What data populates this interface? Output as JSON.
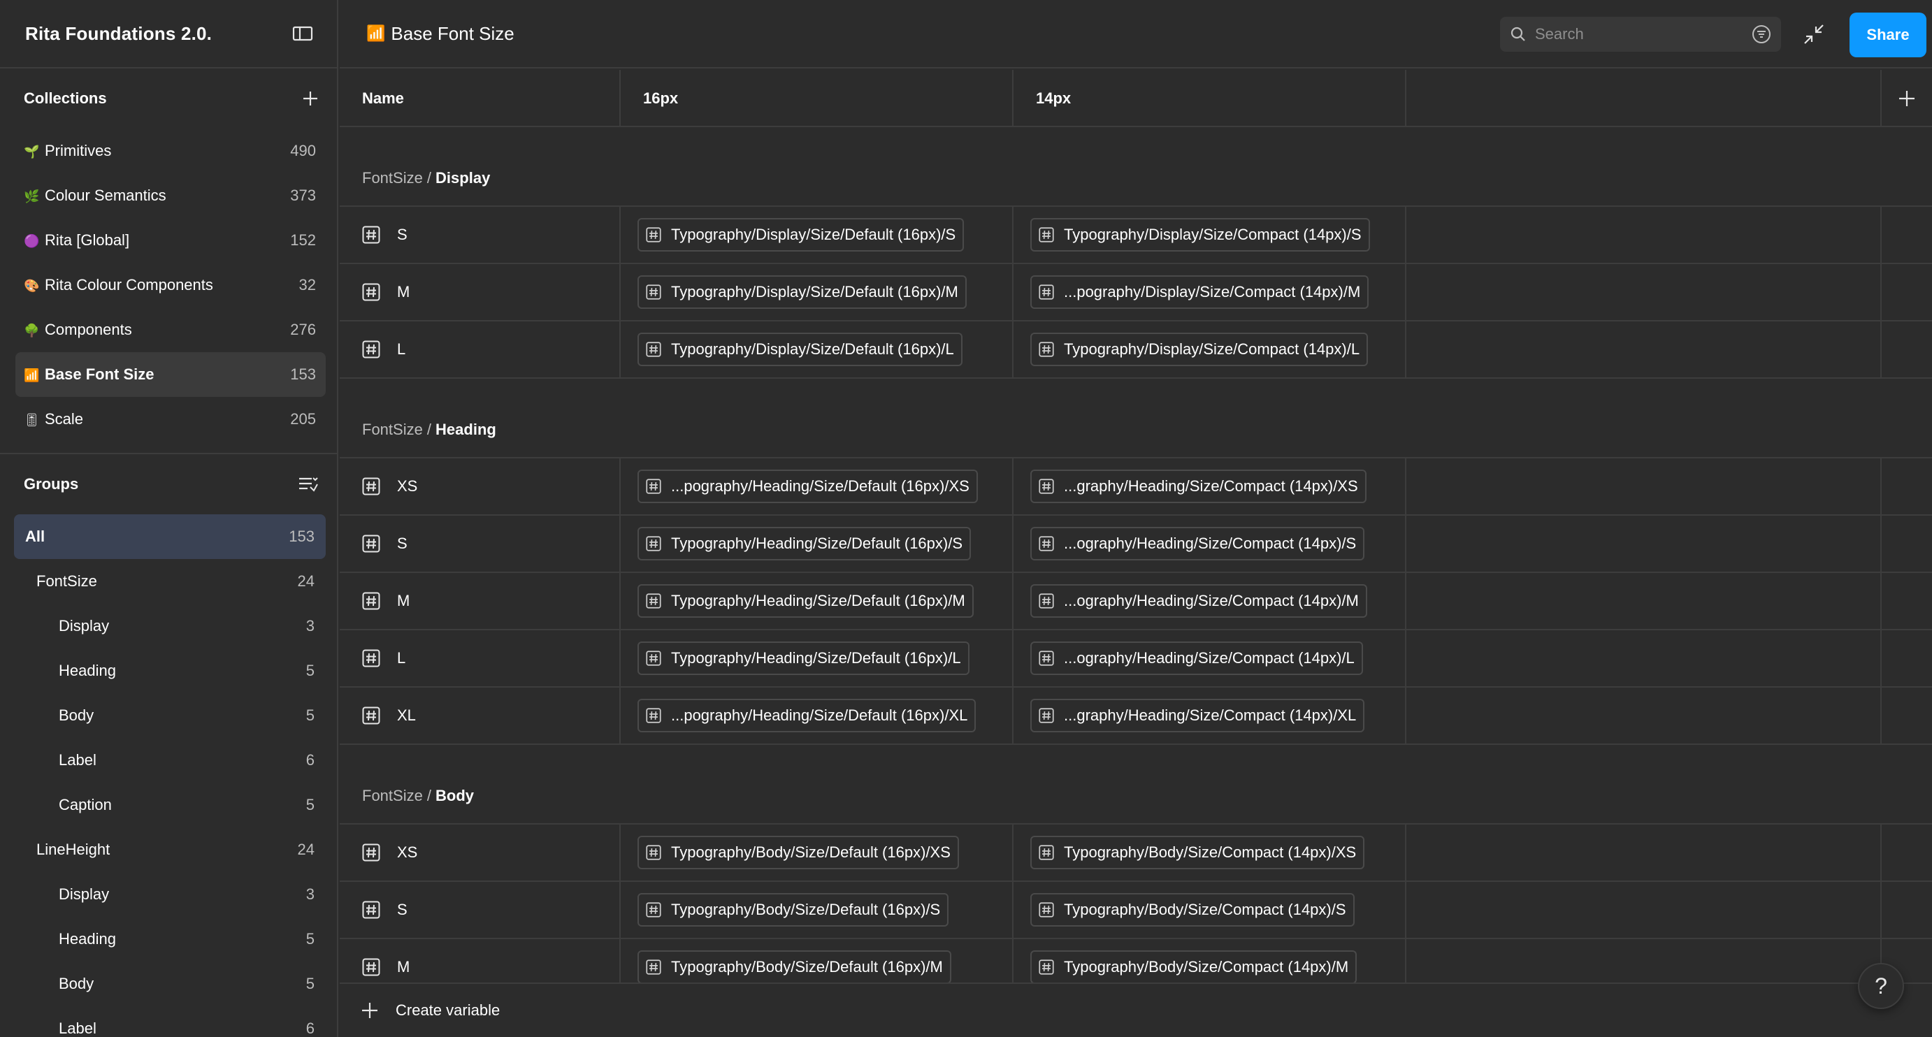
{
  "sidebar": {
    "title": "Rita Foundations 2.0.",
    "collections_title": "Collections",
    "collections": [
      {
        "emoji": "🌱",
        "label": "Primitives",
        "count": "490"
      },
      {
        "emoji": "🌿",
        "label": "Colour Semantics",
        "count": "373"
      },
      {
        "emoji": "🟣",
        "label": "Rita [Global]",
        "count": "152"
      },
      {
        "emoji": "🎨",
        "label": "Rita Colour Components",
        "count": "32"
      },
      {
        "emoji": "🌳",
        "label": "Components",
        "count": "276"
      },
      {
        "emoji": "📶",
        "label": "Base Font Size",
        "count": "153"
      },
      {
        "emoji": "🎚",
        "label": "Scale",
        "count": "205"
      }
    ],
    "groups_title": "Groups",
    "groups": [
      {
        "label": "All",
        "count": "153",
        "level": 0
      },
      {
        "label": "FontSize",
        "count": "24",
        "level": 1
      },
      {
        "label": "Display",
        "count": "3",
        "level": 2
      },
      {
        "label": "Heading",
        "count": "5",
        "level": 2
      },
      {
        "label": "Body",
        "count": "5",
        "level": 2
      },
      {
        "label": "Label",
        "count": "6",
        "level": 2
      },
      {
        "label": "Caption",
        "count": "5",
        "level": 2
      },
      {
        "label": "LineHeight",
        "count": "24",
        "level": 1
      },
      {
        "label": "Display",
        "count": "3",
        "level": 2
      },
      {
        "label": "Heading",
        "count": "5",
        "level": 2
      },
      {
        "label": "Body",
        "count": "5",
        "level": 2
      },
      {
        "label": "Label",
        "count": "6",
        "level": 2
      }
    ]
  },
  "header": {
    "emoji": "📶",
    "title": "Base Font Size",
    "search_placeholder": "Search",
    "share_label": "Share"
  },
  "table": {
    "columns": {
      "name": "Name",
      "mode1": "16px",
      "mode2": "14px"
    },
    "groups": [
      {
        "path": "FontSize /",
        "name": "Display",
        "rows": [
          {
            "name": "S",
            "v1": "Typography/Display/Size/Default (16px)/S",
            "v2": "Typography/Display/Size/Compact (14px)/S"
          },
          {
            "name": "M",
            "v1": "Typography/Display/Size/Default (16px)/M",
            "v2": "...pography/Display/Size/Compact (14px)/M"
          },
          {
            "name": "L",
            "v1": "Typography/Display/Size/Default (16px)/L",
            "v2": "Typography/Display/Size/Compact (14px)/L"
          }
        ]
      },
      {
        "path": "FontSize /",
        "name": "Heading",
        "rows": [
          {
            "name": "XS",
            "v1": "...pography/Heading/Size/Default (16px)/XS",
            "v2": "...graphy/Heading/Size/Compact (14px)/XS"
          },
          {
            "name": "S",
            "v1": "Typography/Heading/Size/Default (16px)/S",
            "v2": "...ography/Heading/Size/Compact (14px)/S"
          },
          {
            "name": "M",
            "v1": "Typography/Heading/Size/Default (16px)/M",
            "v2": "...ography/Heading/Size/Compact (14px)/M"
          },
          {
            "name": "L",
            "v1": "Typography/Heading/Size/Default (16px)/L",
            "v2": "...ography/Heading/Size/Compact (14px)/L"
          },
          {
            "name": "XL",
            "v1": "...pography/Heading/Size/Default (16px)/XL",
            "v2": "...graphy/Heading/Size/Compact (14px)/XL"
          }
        ]
      },
      {
        "path": "FontSize /",
        "name": "Body",
        "rows": [
          {
            "name": "XS",
            "v1": "Typography/Body/Size/Default (16px)/XS",
            "v2": "Typography/Body/Size/Compact (14px)/XS"
          },
          {
            "name": "S",
            "v1": "Typography/Body/Size/Default (16px)/S",
            "v2": "Typography/Body/Size/Compact (14px)/S"
          },
          {
            "name": "M",
            "v1": "Typography/Body/Size/Default (16px)/M",
            "v2": "Typography/Body/Size/Compact (14px)/M"
          }
        ]
      }
    ]
  },
  "footer": {
    "create_label": "Create variable",
    "help_label": "?"
  },
  "colors": {
    "background": "#2c2c2c",
    "border": "#3d3d3d",
    "accent": "#0d99ff",
    "group_selected": "#3a4254"
  }
}
